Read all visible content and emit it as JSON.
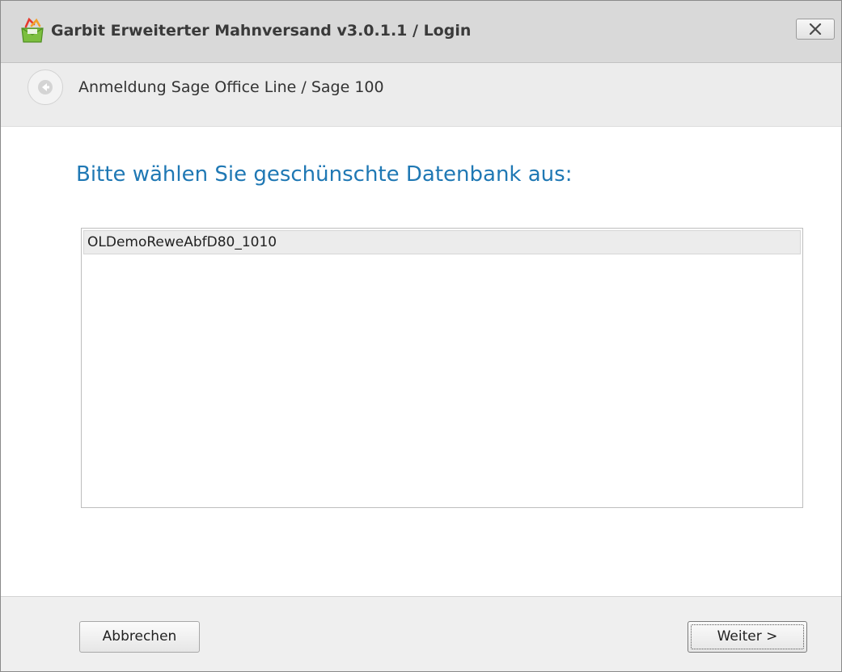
{
  "window": {
    "title": "Garbit Erweiterter Mahnversand v3.0.1.1 / Login",
    "icon": "garbit-app-icon",
    "close_icon": "close-icon"
  },
  "header": {
    "back_icon": "back-arrow-icon",
    "title": "Anmeldung Sage Office Line / Sage 100"
  },
  "main": {
    "instruction": "Bitte wählen Sie geschünschte Datenbank aus:",
    "database_list": {
      "items": [
        {
          "label": "OLDemoReweAbfD80_1010",
          "selected": true
        }
      ]
    }
  },
  "footer": {
    "cancel_label": "Abbrechen",
    "next_label": "Weiter >"
  },
  "colors": {
    "accent": "#1f78b4",
    "titlebar": "#d9d9d9",
    "header": "#ececec",
    "footer": "#efefef"
  }
}
